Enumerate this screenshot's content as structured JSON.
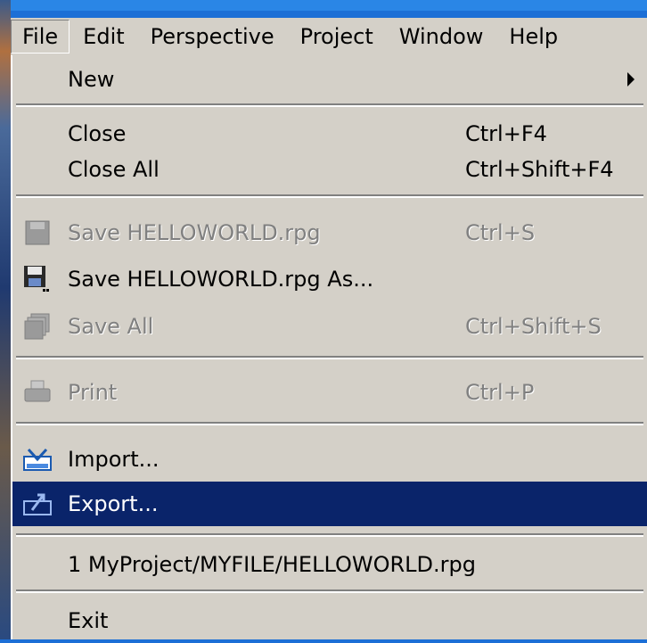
{
  "menubar": {
    "items": [
      "File",
      "Edit",
      "Perspective",
      "Project",
      "Window",
      "Help"
    ]
  },
  "file_menu": {
    "new": {
      "label": "New"
    },
    "close": {
      "label": "Close",
      "accel": "Ctrl+F4"
    },
    "close_all": {
      "label": "Close All",
      "accel": "Ctrl+Shift+F4"
    },
    "save": {
      "label": "Save HELLOWORLD.rpg",
      "accel": "Ctrl+S",
      "icon": "floppy-disk-icon"
    },
    "save_as": {
      "label": "Save HELLOWORLD.rpg As...",
      "icon": "save-as-icon"
    },
    "save_all": {
      "label": "Save All",
      "accel": "Ctrl+Shift+S",
      "icon": "save-all-icon"
    },
    "print": {
      "label": "Print",
      "accel": "Ctrl+P",
      "icon": "printer-icon"
    },
    "import": {
      "label": "Import...",
      "icon": "import-icon"
    },
    "export": {
      "label": "Export...",
      "icon": "export-icon"
    },
    "recent": {
      "label": "1 MyProject/MYFILE/HELLOWORLD.rpg"
    },
    "exit": {
      "label": "Exit"
    }
  },
  "colors": {
    "menu_bg": "#d4d0c8",
    "highlight": "#0a246a",
    "disabled_text": "#808080",
    "desktop": "#1c6fd6"
  }
}
